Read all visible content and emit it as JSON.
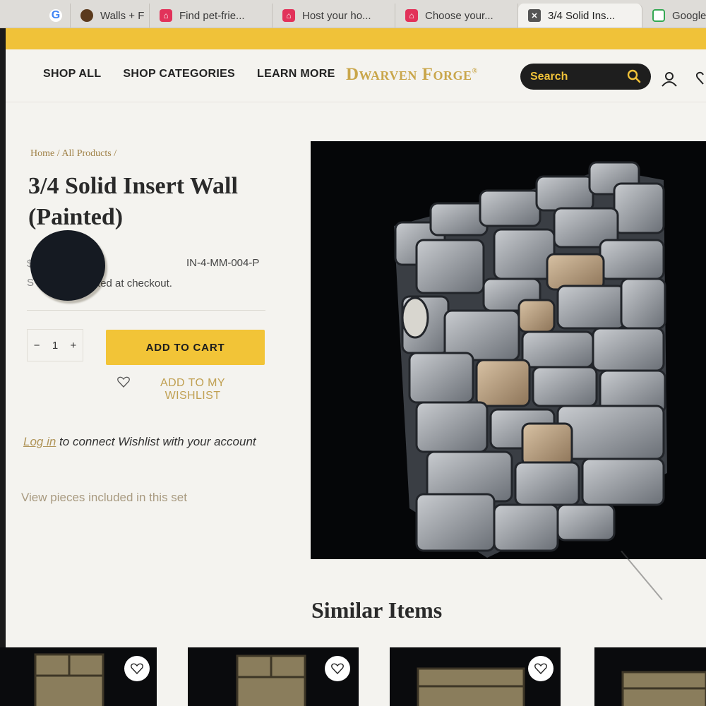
{
  "browser": {
    "tabs": [
      {
        "label": "G",
        "icon": "google-icon"
      },
      {
        "label": "Walls + F",
        "icon": "walls-site-icon"
      },
      {
        "label": "Find pet-frie...",
        "icon": "airbnb-icon"
      },
      {
        "label": "Host your ho...",
        "icon": "airbnb-icon"
      },
      {
        "label": "Choose your...",
        "icon": "airbnb-icon"
      },
      {
        "label": "3/4 Solid Ins...",
        "icon": "dwarven-forge-icon"
      },
      {
        "label": "Google",
        "icon": "google-docs-icon"
      }
    ]
  },
  "header": {
    "nav": [
      "SHOP ALL",
      "SHOP CATEGORIES",
      "LEARN MORE"
    ],
    "logo": "Dwarven Forge",
    "search_placeholder": "Search",
    "accent": "#f0c239"
  },
  "product": {
    "breadcrumb": "Home / All Products /",
    "title": "3/4 Solid Insert Wall (Painted)",
    "sku": "IN-4-MM-004-P",
    "price_prefix": "$",
    "price_note_prefix": "S",
    "price_note": "ted at checkout.",
    "quantity": "1",
    "qty_minus": "−",
    "qty_plus": "+",
    "add_to_cart": "ADD TO CART",
    "wishlist": "ADD TO MY WISHLIST",
    "login_link": "Log in",
    "login_rest": " to connect Wishlist with your account",
    "view_pieces": "View pieces included in this set"
  },
  "similar": {
    "heading": "Similar Items"
  }
}
